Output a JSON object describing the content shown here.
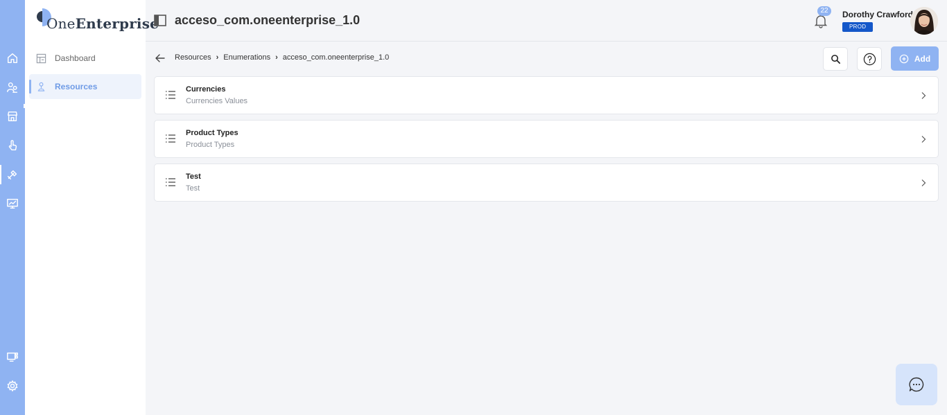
{
  "app": {
    "logo_prefix": "One",
    "logo_suffix": "Enterprise",
    "brand_color": "#8fb3f2",
    "accent_color": "#1457c9"
  },
  "rail": {
    "items": [
      "home-icon",
      "users-icon",
      "store-icon",
      "touch-icon",
      "tools-icon",
      "monitor-chart-icon"
    ],
    "bottom": [
      "monitor-grid-icon",
      "gear-icon"
    ],
    "active": "tools-icon"
  },
  "sidebar": {
    "items": [
      {
        "label": "Dashboard",
        "icon": "dashboard-icon",
        "active": false
      },
      {
        "label": "Resources",
        "icon": "resources-icon",
        "active": true
      }
    ]
  },
  "header": {
    "title": "acceso_com.oneenterprise_1.0",
    "notifications_count": "22",
    "user_name": "Dorothy Crawford",
    "environment": "PROD"
  },
  "breadcrumb": {
    "items": [
      "Resources",
      "Enumerations",
      "acceso_com.oneenterprise_1.0"
    ]
  },
  "toolbar": {
    "add_label": "Add"
  },
  "list": {
    "items": [
      {
        "title": "Currencies",
        "subtitle": "Currencies Values"
      },
      {
        "title": "Product Types",
        "subtitle": "Product Types"
      },
      {
        "title": "Test",
        "subtitle": "Test"
      }
    ]
  }
}
